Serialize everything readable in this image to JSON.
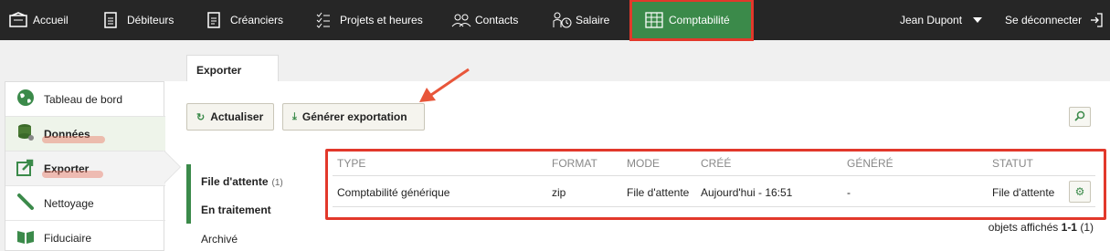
{
  "nav": {
    "items": [
      {
        "label": "Accueil",
        "icon": "home-icon"
      },
      {
        "label": "Débiteurs",
        "icon": "document-icon"
      },
      {
        "label": "Créanciers",
        "icon": "document-icon"
      },
      {
        "label": "Projets et heures",
        "icon": "checklist-icon"
      },
      {
        "label": "Contacts",
        "icon": "contacts-icon"
      },
      {
        "label": "Salaire",
        "icon": "salary-icon"
      },
      {
        "label": "Comptabilité",
        "icon": "ledger-icon"
      }
    ],
    "user": "Jean Dupont",
    "logout": "Se déconnecter"
  },
  "tab": {
    "label": "Exporter"
  },
  "sidebar": {
    "items": [
      {
        "label": "Tableau de bord"
      },
      {
        "label": "Données"
      },
      {
        "label": "Exporter"
      },
      {
        "label": "Nettoyage"
      },
      {
        "label": "Fiduciaire"
      }
    ]
  },
  "toolbar": {
    "refresh_label": "Actualiser",
    "generate_label": "Générer exportation"
  },
  "filters": {
    "queue_label": "File d'attente",
    "queue_count": "(1)",
    "processing_label": "En traitement",
    "archived_label": "Archivé"
  },
  "table": {
    "headers": [
      "TYPE",
      "FORMAT",
      "MODE",
      "CRÉÉ",
      "GÉNÉRÉ",
      "STATUT"
    ],
    "rows": [
      [
        "Comptabilité générique",
        "zip",
        "File d'attente",
        "Aujourd'hui - 16:51",
        "-",
        "File d'attente"
      ]
    ]
  },
  "footer": {
    "prefix": "objets affichés",
    "range": "1-1",
    "total": "(1)"
  },
  "colors": {
    "accent": "#3b8a4a",
    "highlight": "#e2382b",
    "topbar": "#262626"
  }
}
